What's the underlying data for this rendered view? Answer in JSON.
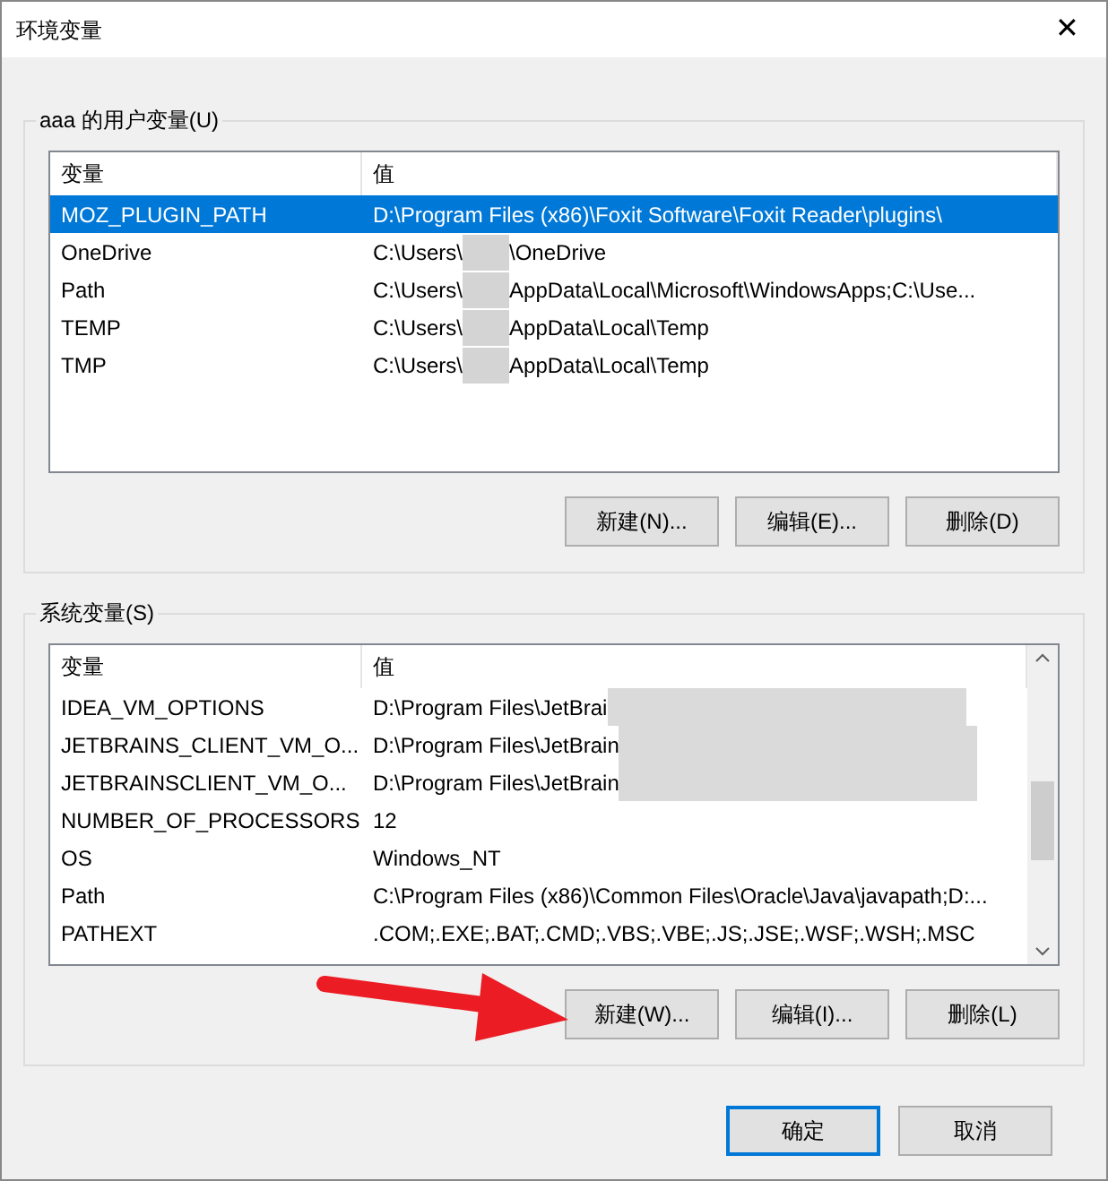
{
  "window": {
    "title": "环境变量",
    "close": "✕"
  },
  "user_vars": {
    "label": "aaa 的用户变量(U)",
    "columns": [
      "变量",
      "值"
    ],
    "rows": [
      {
        "name": "MOZ_PLUGIN_PATH",
        "value": "D:\\Program Files (x86)\\Foxit Software\\Foxit Reader\\plugins\\",
        "selected": true
      },
      {
        "name": "OneDrive",
        "value": "C:\\Users\\",
        "value_end": "\\OneDrive",
        "selected": false
      },
      {
        "name": "Path",
        "value": "C:\\Users\\",
        "value_end": "AppData\\Local\\Microsoft\\WindowsApps;C:\\Use...",
        "selected": false
      },
      {
        "name": "TEMP",
        "value": "C:\\Users\\",
        "value_end": "AppData\\Local\\Temp",
        "selected": false
      },
      {
        "name": "TMP",
        "value": "C:\\Users\\",
        "value_end": "AppData\\Local\\Temp",
        "selected": false
      }
    ],
    "buttons": [
      "新建(N)...",
      "编辑(E)...",
      "删除(D)"
    ]
  },
  "system_vars": {
    "label": "系统变量(S)",
    "columns": [
      "变量",
      "值"
    ],
    "rows": [
      {
        "name": "IDEA_VM_OPTIONS",
        "value": "D:\\Program Files\\JetBrai",
        "redacted": true,
        "selected": false
      },
      {
        "name": "JETBRAINS_CLIENT_VM_O...",
        "value": "D:\\Program Files\\JetBrain",
        "redacted": true,
        "selected": false
      },
      {
        "name": "JETBRAINSCLIENT_VM_O...",
        "value": "D:\\Program Files\\JetBrain",
        "redacted": true,
        "selected": false
      },
      {
        "name": "NUMBER_OF_PROCESSORS",
        "value": "12",
        "selected": false
      },
      {
        "name": "OS",
        "value": "Windows_NT",
        "selected": false
      },
      {
        "name": "Path",
        "value": "C:\\Program Files (x86)\\Common Files\\Oracle\\Java\\javapath;D:...",
        "selected": false
      },
      {
        "name": "PATHEXT",
        "value": ".COM;.EXE;.BAT;.CMD;.VBS;.VBE;.JS;.JSE;.WSF;.WSH;.MSC",
        "selected": false
      }
    ],
    "buttons": [
      "新建(W)...",
      "编辑(I)...",
      "删除(L)"
    ]
  },
  "footer_buttons": [
    {
      "label": "确定",
      "default": true
    },
    {
      "label": "取消",
      "default": false
    }
  ]
}
